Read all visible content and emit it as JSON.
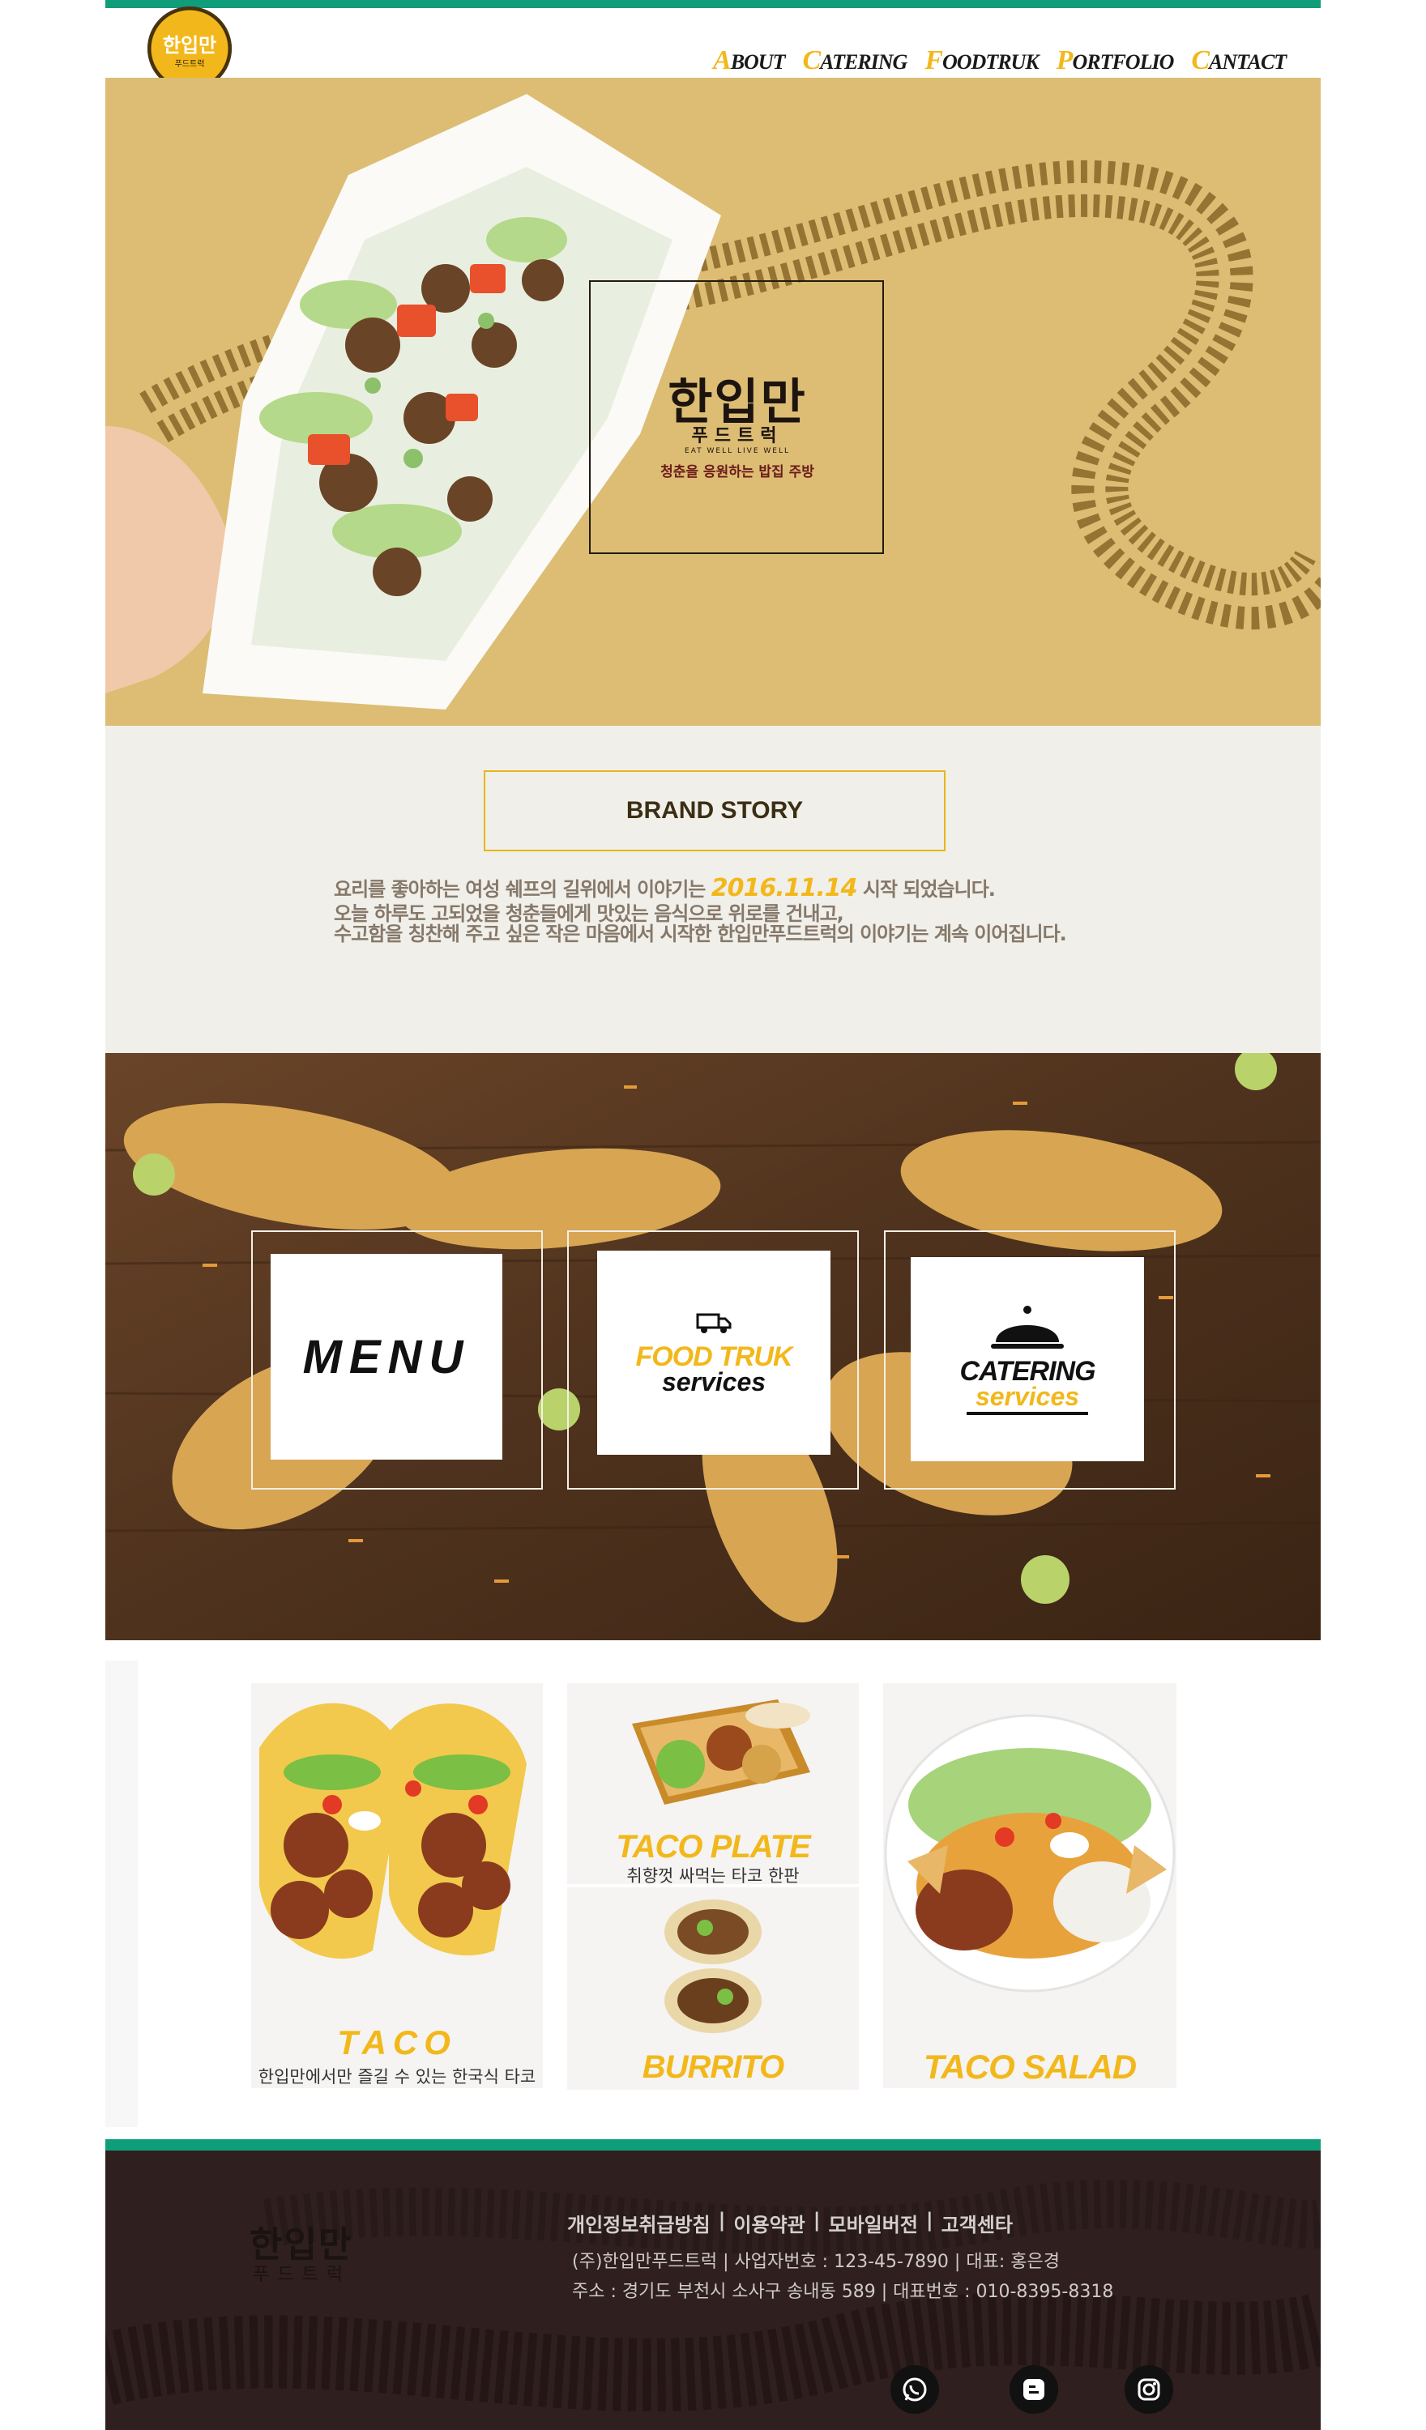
{
  "logo": {
    "text": "한입만",
    "sub": "푸드트럭"
  },
  "nav": [
    {
      "cap": "A",
      "rest": "BOUT"
    },
    {
      "cap": "C",
      "rest": "ATERING"
    },
    {
      "cap": "F",
      "rest": "OODTRUK"
    },
    {
      "cap": "P",
      "rest": "ORTFOLIO"
    },
    {
      "cap": "C",
      "rest": "ANTACT"
    }
  ],
  "hero": {
    "title": "한입만",
    "subtitle": "푸드트럭",
    "tagline": "EAT WELL LIVE WELL",
    "slogan": "청춘을 응원하는 밥집 주방"
  },
  "brand": {
    "title": "BRAND STORY",
    "line1_before": "요리를 좋아하는 여성 쉐프의 길위에서 이야기는 ",
    "line1_date": "2016.11.14",
    "line1_after": " 시작 되었습니다.",
    "line2": "오늘 하루도 고되었을 청춘들에게 맛있는 음식으로 위로를 건내고,",
    "line3": "수고함을 칭찬해 주고 싶은 작은 마음에서 시작한 한입만푸드트럭의 이야기는 계속 이어집니다."
  },
  "services": {
    "menu": "MENU",
    "foodtruk_line1": "FOOD TRUK",
    "foodtruk_line2": "services",
    "catering_line1": "CATERING",
    "catering_line2": "services",
    "colors": {
      "accent": "#f2b81b",
      "dark": "#111111"
    }
  },
  "menu_items": {
    "taco": {
      "title": "TACO",
      "desc": "한입만에서만 즐길 수 있는 한국식 타코"
    },
    "taco_plate": {
      "title": "TACO PLATE",
      "desc": "취향껏 싸먹는 타코 한판"
    },
    "burrito": {
      "title": "BURRITO"
    },
    "taco_salad": {
      "title": "TACO SALAD"
    }
  },
  "footer": {
    "logo": "한입만",
    "logo_sub": "푸드트럭",
    "links": [
      "개인정보취급방침",
      "이용약관",
      "모바일버전",
      "고객센타"
    ],
    "company_line": "(주)한입만푸드트럭  |  사업자번호 : 123-45-7890  |  대표: 홍은경",
    "address_line": "주소 : 경기도 부천시 소사구 송내동 589 |  대표번호 : 010-8395-8318",
    "social": [
      "whatsapp-icon",
      "blogger-icon",
      "instagram-icon"
    ]
  },
  "colors": {
    "brand_green": "#0f9d7a",
    "accent_yellow": "#f2b81b",
    "hero_tan": "#dcbd73",
    "footer_bg": "#2f1f1f"
  }
}
